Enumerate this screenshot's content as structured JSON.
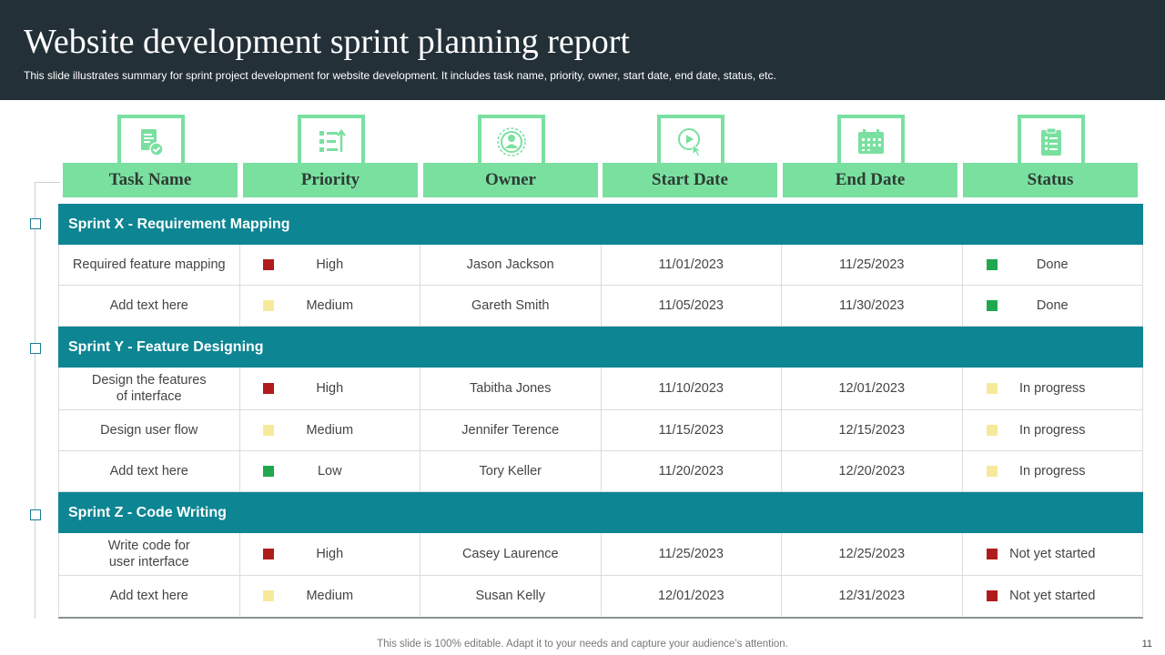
{
  "title": "Website development sprint planning report",
  "subtitle": "This slide illustrates summary for sprint project development for website development. It includes task name, priority, owner, start date, end date, status, etc.",
  "columns": [
    {
      "label": "Task Name",
      "icon": "document-check-icon"
    },
    {
      "label": "Priority",
      "icon": "list-priority-icon"
    },
    {
      "label": "Owner",
      "icon": "user-icon"
    },
    {
      "label": "Start Date",
      "icon": "play-click-icon"
    },
    {
      "label": "End Date",
      "icon": "calendar-icon"
    },
    {
      "label": "Status",
      "icon": "clipboard-checklist-icon"
    }
  ],
  "colors": {
    "high": "#b01c1c",
    "medium": "#f6ea9a",
    "low": "#1fa84f",
    "done": "#1fa84f",
    "in_progress": "#f6ea9a",
    "not_started": "#b01c1c",
    "sprint_bar": "#0d8593",
    "header_bg": "#243038",
    "accent_green": "#79e0a0"
  },
  "sprints": [
    {
      "name": "Sprint X - Requirement Mapping",
      "tasks": [
        {
          "task": [
            "Required feature mapping"
          ],
          "priority": "High",
          "owner": "Jason Jackson",
          "start": "11/01/2023",
          "end": "11/25/2023",
          "status": "Done"
        },
        {
          "task": [
            "Add text here"
          ],
          "priority": "Medium",
          "owner": "Gareth Smith",
          "start": "11/05/2023",
          "end": "11/30/2023",
          "status": "Done"
        }
      ]
    },
    {
      "name": "Sprint Y - Feature Designing",
      "tasks": [
        {
          "task": [
            "Design the features",
            "of interface"
          ],
          "priority": "High",
          "owner": "Tabitha Jones",
          "start": "11/10/2023",
          "end": "12/01/2023",
          "status": "In progress"
        },
        {
          "task": [
            "Design user flow"
          ],
          "priority": "Medium",
          "owner": "Jennifer Terence",
          "start": "11/15/2023",
          "end": "12/15/2023",
          "status": "In progress"
        },
        {
          "task": [
            "Add text here"
          ],
          "priority": "Low",
          "owner": "Tory Keller",
          "start": "11/20/2023",
          "end": "12/20/2023",
          "status": "In progress"
        }
      ]
    },
    {
      "name": "Sprint Z - Code Writing",
      "tasks": [
        {
          "task": [
            "Write code for",
            "user interface"
          ],
          "priority": "High",
          "owner": "Casey Laurence",
          "start": "11/25/2023",
          "end": "12/25/2023",
          "status": "Not yet started"
        },
        {
          "task": [
            "Add text here"
          ],
          "priority": "Medium",
          "owner": "Susan Kelly",
          "start": "12/01/2023",
          "end": "12/31/2023",
          "status": "Not yet started"
        }
      ]
    }
  ],
  "footer": "This slide is 100% editable. Adapt it to your needs and capture your audience’s attention.",
  "page_number": "11"
}
